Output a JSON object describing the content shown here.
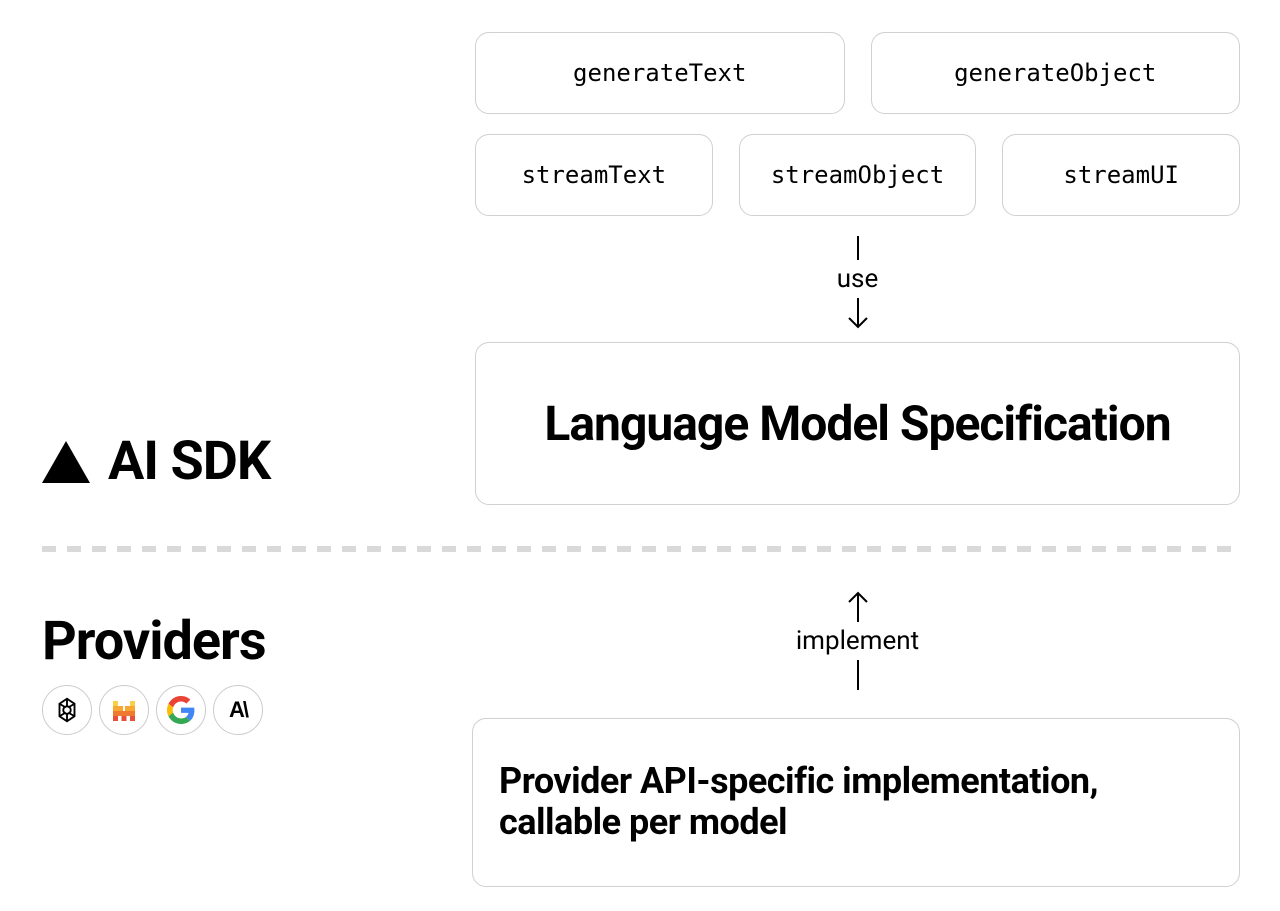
{
  "sdk": {
    "label": "AI SDK"
  },
  "functions": {
    "row1": [
      {
        "name": "generateText"
      },
      {
        "name": "generateObject"
      }
    ],
    "row2": [
      {
        "name": "streamText"
      },
      {
        "name": "streamObject"
      },
      {
        "name": "streamUI"
      }
    ]
  },
  "arrows": {
    "use": "use",
    "implement": "implement"
  },
  "spec": {
    "title": "Language Model Specification"
  },
  "providers": {
    "title": "Providers",
    "items": [
      "openai",
      "mistral",
      "google",
      "anthropic"
    ]
  },
  "providerBox": {
    "text": "Provider API-specific implementation, callable per model"
  }
}
